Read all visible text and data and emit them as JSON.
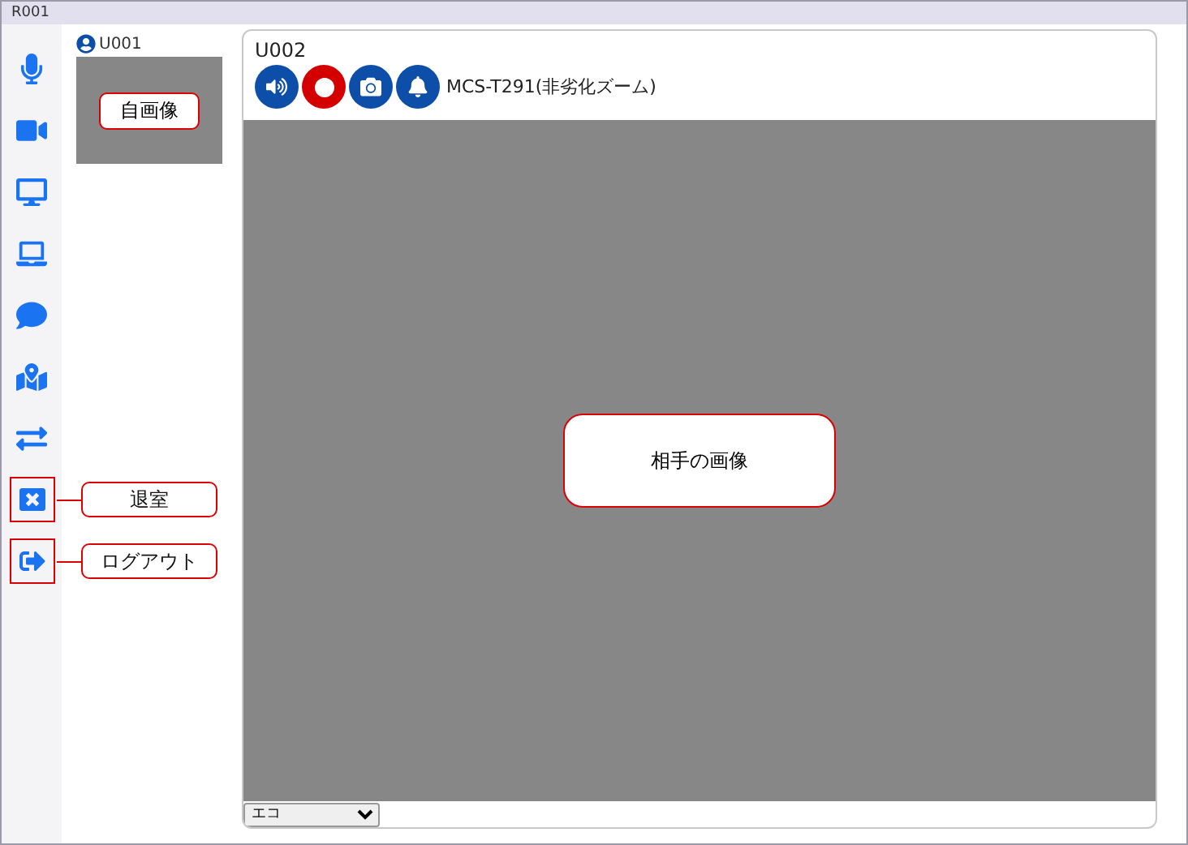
{
  "window": {
    "title": "R001"
  },
  "sidebar": {
    "items": [
      {
        "kind": "plain"
      },
      {
        "kind": "plain"
      },
      {
        "kind": "plain"
      },
      {
        "kind": "plain"
      },
      {
        "kind": "plain"
      },
      {
        "kind": "plain"
      },
      {
        "kind": "plain"
      },
      {
        "kind": "boxed",
        "callout": "退室"
      },
      {
        "kind": "boxed",
        "callout": "ログアウト"
      }
    ]
  },
  "self_view": {
    "user": "U001",
    "callout": "自画像"
  },
  "remote_view": {
    "user": "U002",
    "buttons": [
      {
        "kind": "speaker"
      },
      {
        "kind": "record"
      },
      {
        "kind": "camera"
      },
      {
        "kind": "bell"
      }
    ],
    "device": "MCS-T291(非劣化ズーム)",
    "callout": "相手の画像",
    "quality_select": {
      "value": "エコ"
    }
  }
}
